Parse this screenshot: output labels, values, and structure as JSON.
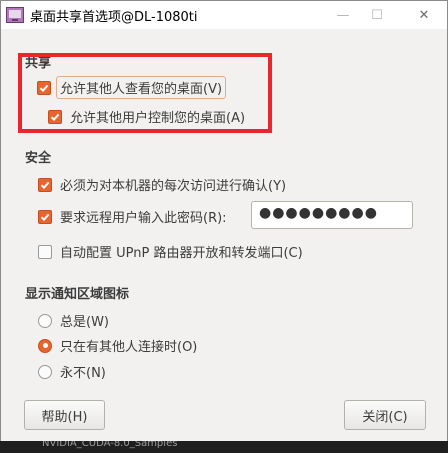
{
  "window": {
    "title": "桌面共享首选项@DL-1080ti",
    "minimize_glyph": "—",
    "maximize_glyph": "☐",
    "close_glyph": "✕"
  },
  "sharing": {
    "title": "共享",
    "allow_view_label": "允许其他人查看您的桌面(V)",
    "allow_view_checked": true,
    "allow_control_label": "允许其他用户控制您的桌面(A)",
    "allow_control_checked": true
  },
  "security": {
    "title": "安全",
    "confirm_label": "必须为对本机器的每次访问进行确认(Y)",
    "confirm_checked": true,
    "password_label": "要求远程用户输入此密码(R):",
    "password_checked": true,
    "password_value": "●●●●●●●●●",
    "upnp_label": "自动配置 UPnP 路由器开放和转发端口(C)",
    "upnp_checked": false
  },
  "notify": {
    "title": "显示通知区域图标",
    "options": [
      {
        "label": "总是(W)",
        "selected": false
      },
      {
        "label": "只在有其他人连接时(O)",
        "selected": true
      },
      {
        "label": "永不(N)",
        "selected": false
      }
    ]
  },
  "buttons": {
    "help_label": "帮助(H)",
    "close_label": "关闭(C)"
  },
  "background_text": "NVIDIA_CUDA-8.0_Samples",
  "colors": {
    "accent": "#e9652f",
    "highlight_box": "#e8262c",
    "window_bg": "#f2f1f0"
  }
}
